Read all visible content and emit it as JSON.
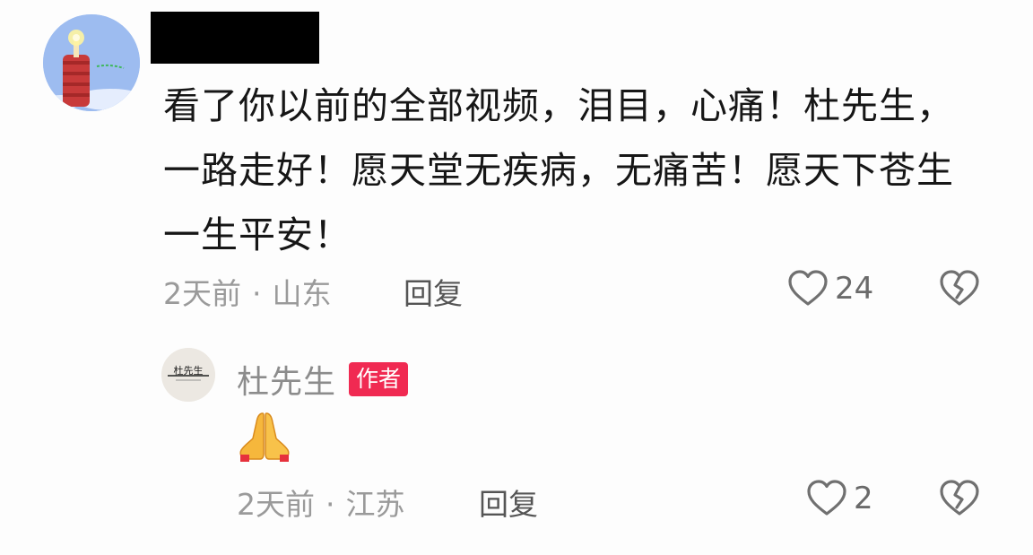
{
  "comment": {
    "avatar_icon": "avatar-icon",
    "text": "看了你以前的全部视频，泪目，心痛！杜先生，一路走好！愿天堂无疾病，无痛苦！愿天下苍生一生平安！",
    "time": "2天前",
    "separator": "·",
    "location": "山东",
    "reply_label": "回复",
    "like_icon": "heart-outline-icon",
    "like_count": "24",
    "dislike_icon": "broken-heart-icon"
  },
  "reply": {
    "avatar_icon": "avatar-icon",
    "avatar_text": "杜先生",
    "author_name": "杜先生",
    "badge": "作者",
    "emoji_icon": "folded-hands-icon",
    "time": "2天前",
    "separator": "·",
    "location": "江苏",
    "reply_label": "回复",
    "like_icon": "heart-outline-icon",
    "like_count": "2",
    "dislike_icon": "broken-heart-icon"
  },
  "colors": {
    "badge_bg": "#f02a52",
    "text_primary": "#161616",
    "text_meta": "#9a9a9a",
    "icon": "#707070"
  }
}
